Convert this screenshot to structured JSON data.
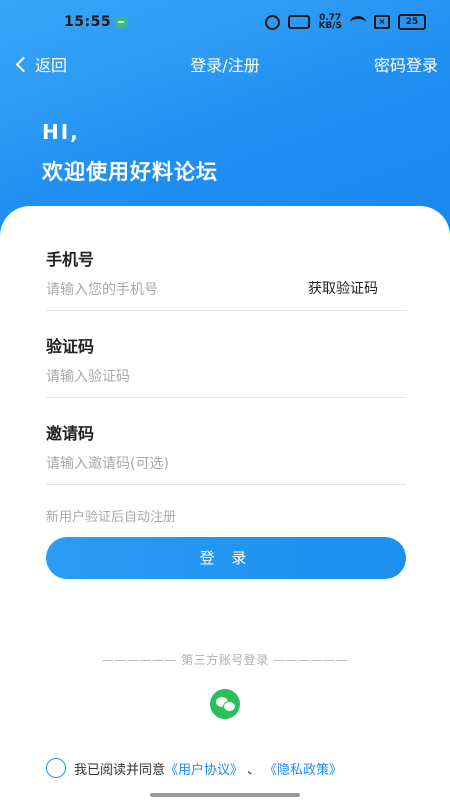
{
  "status_bar": {
    "time": "15:55",
    "network_speed": "0.77\nKB/S",
    "battery": "25"
  },
  "nav": {
    "back_label": "返回",
    "title": "登录/注册",
    "password_login_label": "密码登录"
  },
  "greeting": {
    "line1": "HI,",
    "line2": "欢迎使用好料论坛"
  },
  "form": {
    "phone": {
      "label": "手机号",
      "placeholder": "请输入您的手机号",
      "get_code_label": "获取验证码"
    },
    "code": {
      "label": "验证码",
      "placeholder": "请输入验证码"
    },
    "invite": {
      "label": "邀请码",
      "placeholder": "请输入邀请码(可选)"
    },
    "hint": "新用户验证后自动注册",
    "login_button": "登 录"
  },
  "third_party": {
    "label": "—————— 第三方账号登录 ——————",
    "icons": [
      "wechat-icon"
    ]
  },
  "agreement": {
    "prefix": "我已阅读并同意",
    "user_agreement": "《用户协议》",
    "separator": "、",
    "privacy_policy": "《隐私政策》"
  },
  "colors": {
    "accent": "#1f8ef2",
    "wechat": "#2bc15a"
  }
}
